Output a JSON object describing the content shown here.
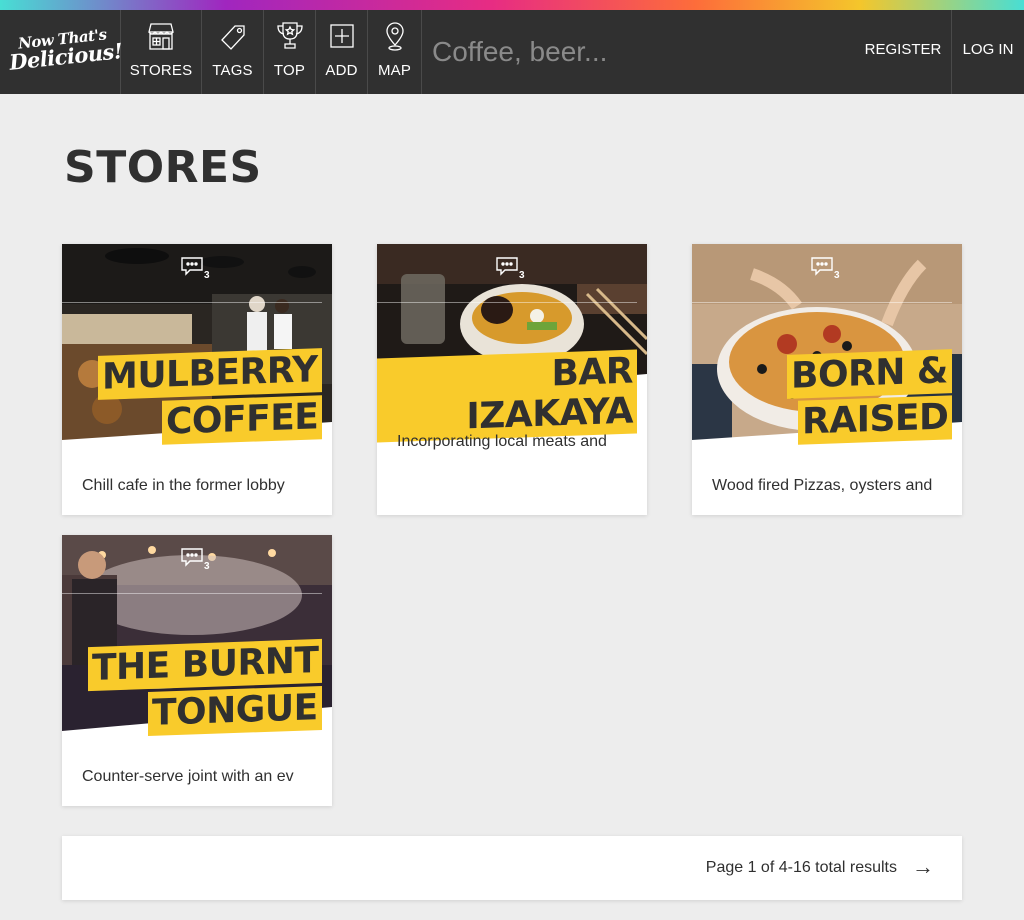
{
  "brand": {
    "line1": "Now That's",
    "line2": "Delicious!"
  },
  "nav": {
    "items": [
      {
        "label": "STORES",
        "icon": "store-icon"
      },
      {
        "label": "TAGS",
        "icon": "tag-icon"
      },
      {
        "label": "TOP",
        "icon": "trophy-icon"
      },
      {
        "label": "ADD",
        "icon": "add-icon"
      },
      {
        "label": "MAP",
        "icon": "map-pin-icon"
      }
    ],
    "search_placeholder": "Coffee, beer...",
    "register": "REGISTER",
    "login": "LOG IN"
  },
  "page": {
    "title": "STORES"
  },
  "stores": [
    {
      "name_line1": "MULBERRY",
      "name_line2": "COFFEE",
      "description": "Chill cafe in the former lobby",
      "reviews": "3"
    },
    {
      "name_line1": "BAR IZAKAYA",
      "name_line2": "",
      "description": "Incorporating local meats and",
      "reviews": "3"
    },
    {
      "name_line1": "BORN &",
      "name_line2": "RAISED",
      "description": "Wood fired Pizzas, oysters and",
      "reviews": "3"
    },
    {
      "name_line1": "THE BURNT",
      "name_line2": "TONGUE",
      "description": "Counter-serve joint with an ev",
      "reviews": "3"
    }
  ],
  "pagination": {
    "text": "Page 1 of 4-16 total results",
    "next": "→"
  },
  "colors": {
    "accent": "#f9cb2b",
    "nav_bg": "#303030",
    "page_bg": "#ededed"
  }
}
